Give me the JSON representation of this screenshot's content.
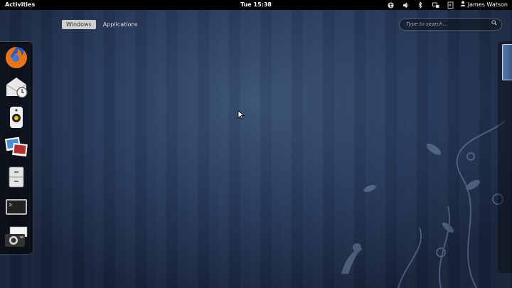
{
  "topbar": {
    "activities_label": "Activities",
    "clock": "Tue 15:38",
    "tray_icons": [
      "accessibility-icon",
      "volume-icon",
      "bluetooth-icon",
      "network-icon",
      "battery-icon"
    ],
    "user_name": "James Watson"
  },
  "overview": {
    "tabs": [
      {
        "label": "Windows",
        "active": true
      },
      {
        "label": "Applications",
        "active": false
      }
    ],
    "search": {
      "placeholder": "Type to search..."
    }
  },
  "dash": {
    "apps": [
      "firefox-icon",
      "evolution-mail-icon",
      "rhythmbox-icon",
      "shotwell-icon",
      "files-icon",
      "terminal-icon",
      "cheese-camera-icon"
    ]
  },
  "colors": {
    "topbar": "#000000",
    "background": "#203350",
    "active_tab": "#d0d0d0"
  }
}
